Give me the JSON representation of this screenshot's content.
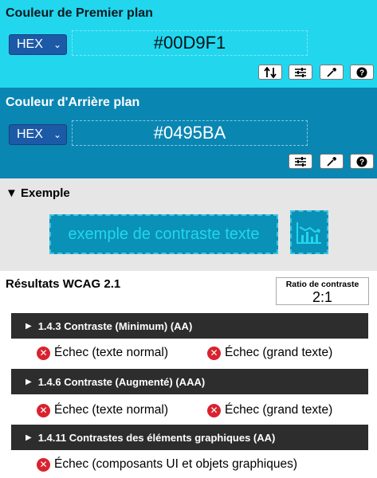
{
  "foreground": {
    "title": "Couleur de Premier plan",
    "format": "HEX",
    "value": "#00D9F1",
    "color": "#00D9F1",
    "tools": [
      "swap-icon",
      "sliders-icon",
      "eyedropper-icon",
      "help-icon"
    ]
  },
  "background": {
    "title": "Couleur d'Arrière plan",
    "format": "HEX",
    "value": "#0495BA",
    "color": "#0495BA",
    "tools": [
      "sliders-icon",
      "eyedropper-icon",
      "help-icon"
    ]
  },
  "example": {
    "title": "Exemple",
    "sample_text": "exemple de contraste texte"
  },
  "results": {
    "title": "Résultats WCAG 2.1",
    "ratio_label": "Ratio de contraste",
    "ratio_value": "2:1",
    "criteria": [
      {
        "title": "1.4.3 Contraste (Minimum) (AA)",
        "results": [
          "Échec (texte normal)",
          "Échec (grand texte)"
        ]
      },
      {
        "title": "1.4.6 Contraste (Augmenté) (AAA)",
        "results": [
          "Échec (texte normal)",
          "Échec (grand texte)"
        ]
      },
      {
        "title": "1.4.11 Contrastes des éléments graphiques (AA)",
        "results": [
          "Échec (composants UI et objets graphiques)"
        ]
      }
    ]
  },
  "colors": {
    "fail": "#D8232F",
    "criterion_bar": "#2D2D2D"
  }
}
